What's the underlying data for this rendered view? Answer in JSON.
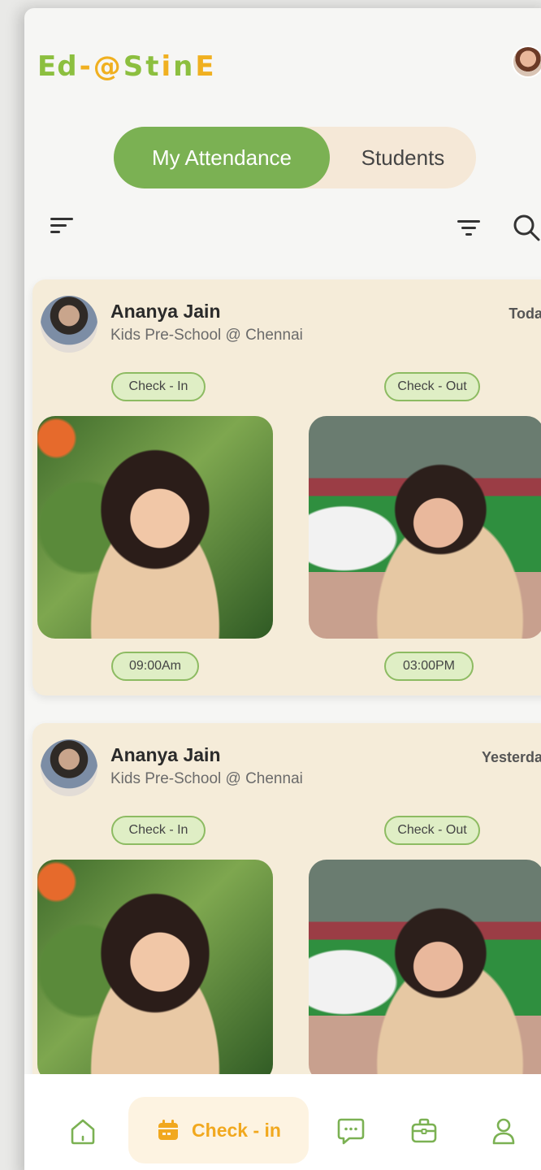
{
  "header": {
    "logo_text": "Ed-@StinE",
    "logo_parts": [
      "Ed",
      "-",
      "@",
      "S",
      "t",
      "i",
      "n",
      "E"
    ]
  },
  "tabs": [
    {
      "label": "My Attendance",
      "active": true
    },
    {
      "label": "Students",
      "active": false
    }
  ],
  "colors": {
    "green": "#7bb153",
    "orange": "#f1a81e",
    "card_bg": "#f5ecd9",
    "tab_bg": "#f5e8d7"
  },
  "cards": [
    {
      "name": "Ananya Jain",
      "school": "Kids Pre-School @ Chennai",
      "day": "Today",
      "check_in_label": "Check - In",
      "check_out_label": "Check - Out",
      "check_in_time": "09:00Am",
      "check_out_time": "03:00PM"
    },
    {
      "name": "Ananya Jain",
      "school": "Kids Pre-School @ Chennai",
      "day": "Yesterday",
      "check_in_label": "Check - In",
      "check_out_label": "Check - Out"
    }
  ],
  "bottom_nav": {
    "items": [
      {
        "icon": "home-icon"
      },
      {
        "icon": "calendar-icon",
        "label": "Check - in",
        "active": true
      },
      {
        "icon": "chat-icon"
      },
      {
        "icon": "briefcase-icon"
      },
      {
        "icon": "profile-icon"
      }
    ]
  }
}
